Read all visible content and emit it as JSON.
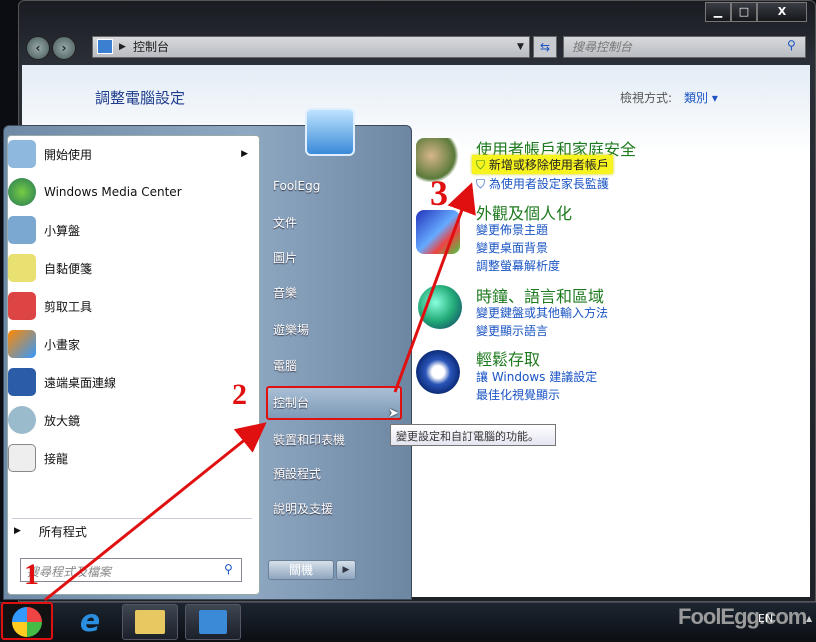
{
  "window": {
    "min": "▁",
    "max": "□",
    "close": "X",
    "breadcrumb": "控制台",
    "search_placeholder": "搜尋控制台"
  },
  "content": {
    "title": "調整電腦設定",
    "view_label": "檢視方式:",
    "view_value": "類別",
    "categories": [
      {
        "title": "使用者帳戶和家庭安全",
        "links": [
          "新增或移除使用者帳戶",
          "為使用者設定家長監護"
        ]
      },
      {
        "title": "外觀及個人化",
        "links": [
          "變更佈景主題",
          "變更桌面背景",
          "調整螢幕解析度"
        ]
      },
      {
        "title": "時鐘、語言和區域",
        "links": [
          "變更鍵盤或其他輸入方法",
          "變更顯示語言"
        ]
      },
      {
        "title": "輕鬆存取",
        "links": [
          "讓 Windows 建議設定",
          "最佳化視覺顯示"
        ]
      }
    ]
  },
  "start_menu": {
    "programs": [
      "開始使用",
      "Windows Media Center",
      "小算盤",
      "自黏便箋",
      "剪取工具",
      "小畫家",
      "遠端桌面連線",
      "放大鏡",
      "接龍"
    ],
    "all_programs": "所有程式",
    "search_placeholder": "搜尋程式及檔案",
    "places": [
      "FoolEgg",
      "文件",
      "圖片",
      "音樂",
      "遊樂場",
      "電腦",
      "控制台",
      "裝置和印表機",
      "預設程式",
      "說明及支援"
    ],
    "shutdown": "關機",
    "tooltip": "變更設定和自訂電腦的功能。"
  },
  "annotations": [
    "1",
    "2",
    "3"
  ],
  "tray": {
    "lang": "EN",
    "watermark": "FoolEgg.com"
  }
}
